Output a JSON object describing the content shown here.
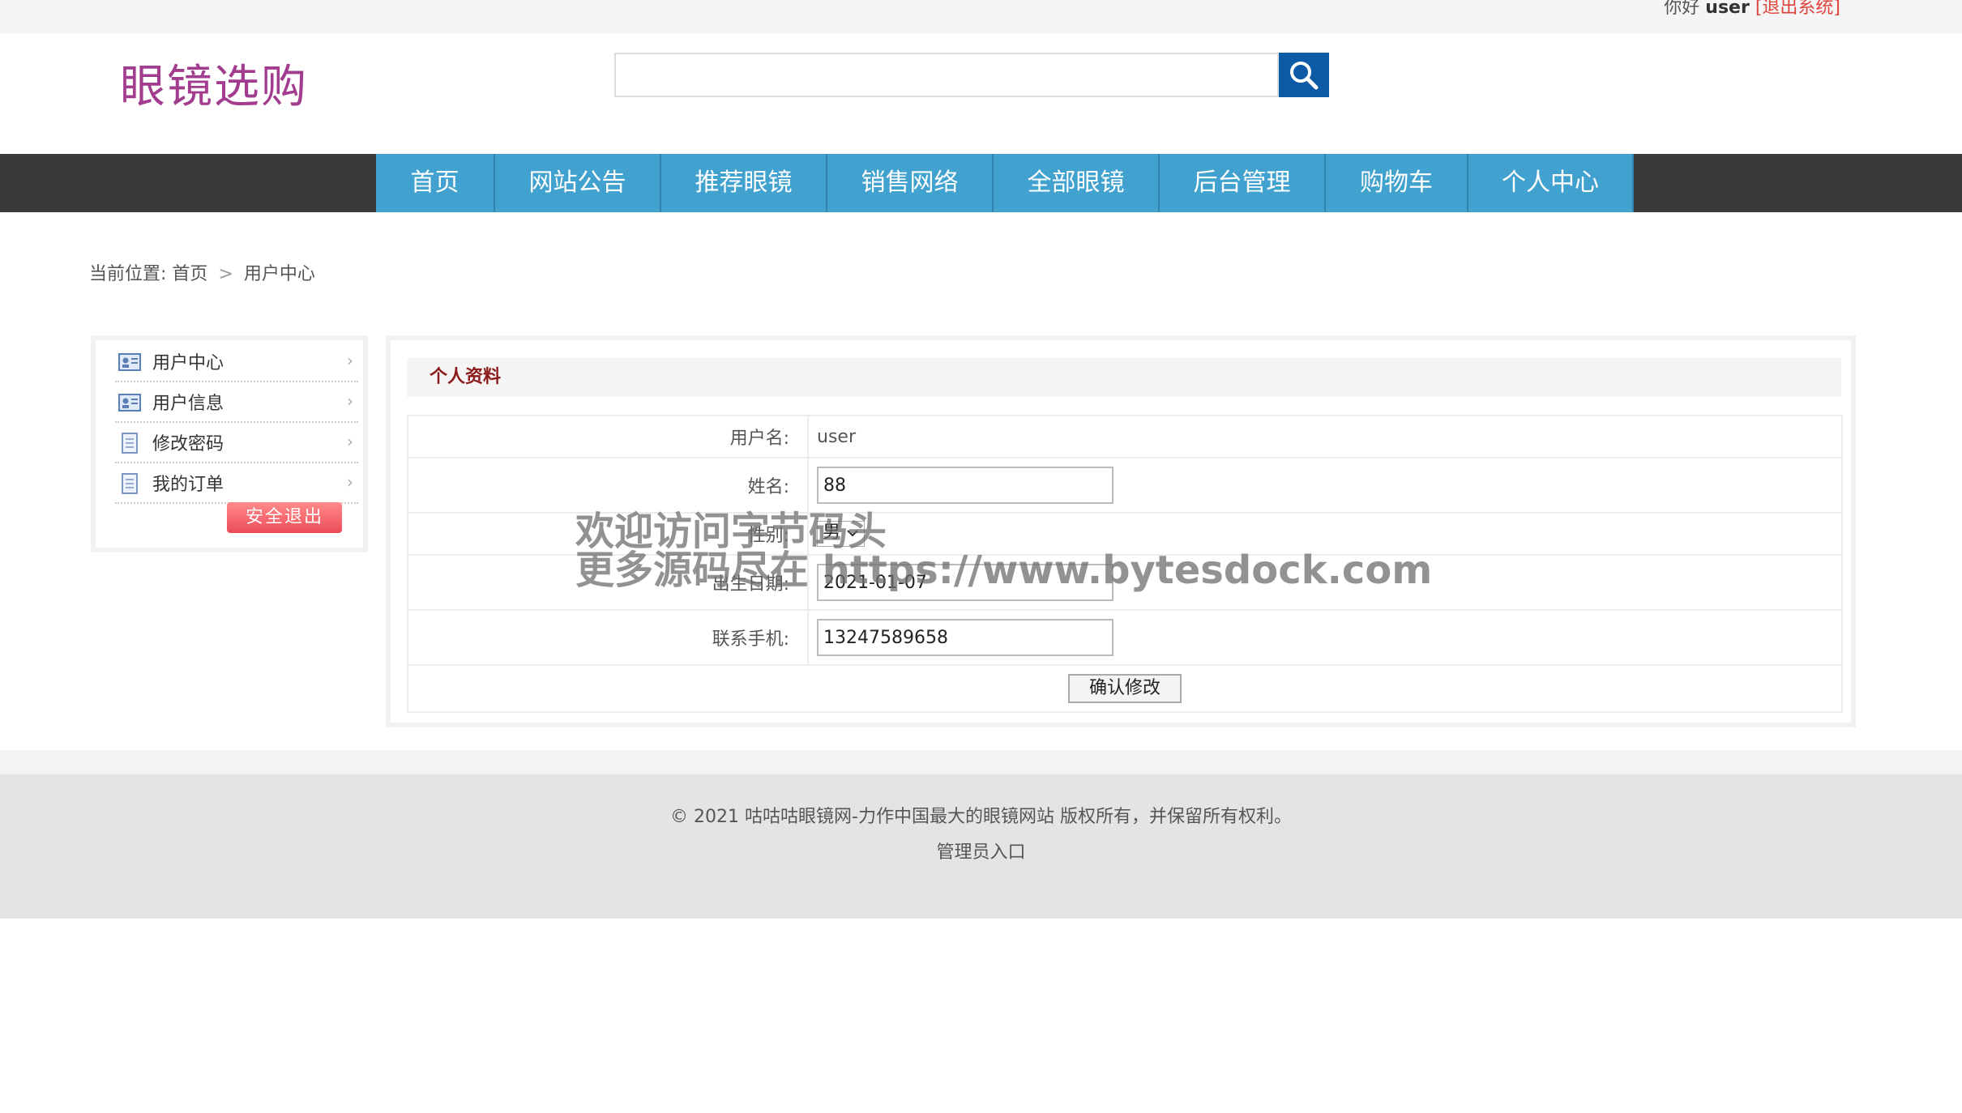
{
  "topbar": {
    "greeting": "你好",
    "username": "user",
    "logout_link": "[退出系统]"
  },
  "header": {
    "logo": "眼镜选购",
    "search_placeholder": ""
  },
  "nav": {
    "items": [
      "首页",
      "网站公告",
      "推荐眼镜",
      "销售网络",
      "全部眼镜",
      "后台管理",
      "购物车",
      "个人中心"
    ]
  },
  "breadcrumb": {
    "prefix": "当前位置:",
    "home": "首页",
    "separator": ">",
    "current": "用户中心"
  },
  "sidebar": {
    "items": [
      {
        "label": "用户中心",
        "icon": "id-card-icon"
      },
      {
        "label": "用户信息",
        "icon": "id-card-icon"
      },
      {
        "label": "修改密码",
        "icon": "document-icon"
      },
      {
        "label": "我的订单",
        "icon": "document-icon"
      }
    ],
    "arrow": "›",
    "logout_button": "安全退出"
  },
  "panel": {
    "title": "个人资料",
    "fields": {
      "username_label": "用户名:",
      "username_value": "user",
      "name_label": "姓名:",
      "name_value": "88",
      "gender_label": "性别:",
      "gender_value": "男",
      "birthday_label": "出生日期:",
      "birthday_value": "2021-01-07",
      "phone_label": "联系手机:",
      "phone_value": "13247589658"
    },
    "submit_button": "确认修改"
  },
  "watermark": {
    "line1": "欢迎访问字节码头",
    "line2": "更多源码尽在 https://www.bytesdock.com"
  },
  "footer": {
    "copyright": "© 2021 咕咕咕眼镜网-力作中国最大的眼镜网站 版权所有，并保留所有权利。",
    "admin_link": "管理员入口"
  },
  "colors": {
    "nav_bg": "#41a1cf",
    "nav_bar": "#3a3a3a",
    "logo": "#a23c8f",
    "search_button": "#0d5aa7",
    "logout_link": "#e0443c",
    "panel_title": "#8b1a1a"
  }
}
